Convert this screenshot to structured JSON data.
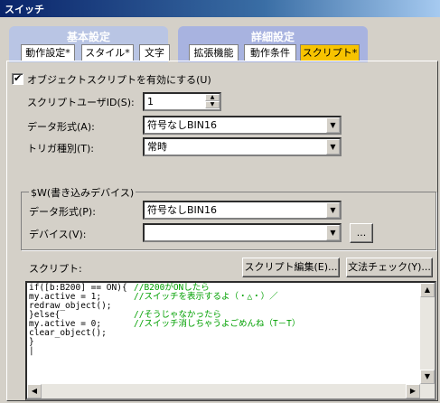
{
  "window": {
    "title": "スイッチ"
  },
  "tab_groups": {
    "basic": {
      "title": "基本設定",
      "tabs": [
        "動作設定*",
        "スタイル*",
        "文字"
      ]
    },
    "detail": {
      "title": "詳細設定",
      "tabs": [
        "拡張機能",
        "動作条件",
        "スクリプト*"
      ]
    }
  },
  "enable_script": {
    "label": "オブジェクトスクリプトを有効にする(U)",
    "checked": true
  },
  "script_user_id": {
    "label": "スクリプトユーザID(S):",
    "value": "1"
  },
  "data_format": {
    "label": "データ形式(A):",
    "value": "符号なしBIN16"
  },
  "trigger_type": {
    "label": "トリガ種別(T):",
    "value": "常時"
  },
  "write_device_group": {
    "title": "$W(書き込みデバイス)",
    "data_format": {
      "label": "データ形式(P):",
      "value": "符号なしBIN16"
    },
    "device": {
      "label": "デバイス(V):",
      "value": "",
      "browse_label": "..."
    }
  },
  "script": {
    "label": "スクリプト:",
    "edit_button": "スクリプト編集(E)...",
    "check_button": "文法チェック(Y)...",
    "lines": [
      {
        "code": "if([b:B200] == ON){",
        "comment": "//B200がONしたら"
      },
      {
        "code": "my.active = 1;",
        "comment": "//スイッチを表示するよ（・△・）／"
      },
      {
        "code": "redraw_object();",
        "comment": ""
      },
      {
        "code": "}else{",
        "comment": "//そうじゃなかったら"
      },
      {
        "code": "my.active = 0;",
        "comment": "//スイッチ消しちゃうよごめんね（T－T）"
      },
      {
        "code": "clear_object();",
        "comment": ""
      },
      {
        "code": "}",
        "comment": ""
      },
      {
        "code": "|",
        "comment": ""
      }
    ]
  }
}
